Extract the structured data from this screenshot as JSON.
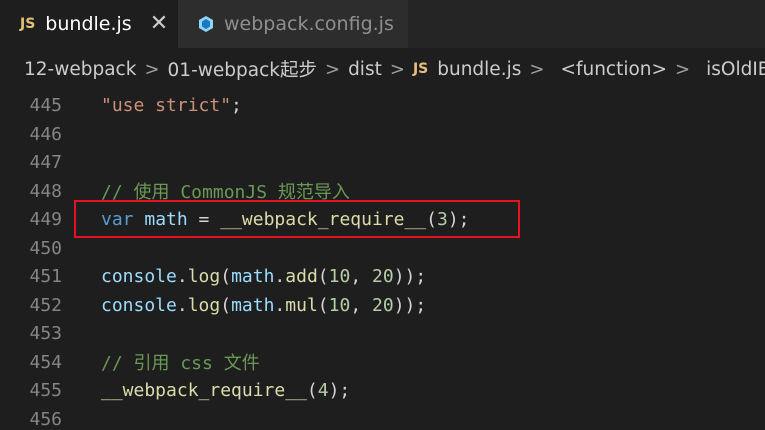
{
  "tabs": [
    {
      "badge": "JS",
      "label": "bundle.js",
      "close": "✕",
      "active": true
    },
    {
      "label": "webpack.config.js",
      "active": false
    }
  ],
  "breadcrumb": {
    "items": [
      "12-webpack",
      "01-webpack起步",
      "dist",
      "bundle.js",
      "<function>",
      "isOldIE"
    ],
    "js_badge": "JS",
    "separator": ">"
  },
  "editor": {
    "lines": [
      {
        "number": "445",
        "tokens": [
          {
            "t": "str",
            "v": "\"use strict\""
          },
          {
            "t": "p",
            "v": ";"
          }
        ]
      },
      {
        "number": "446",
        "tokens": []
      },
      {
        "number": "447",
        "tokens": []
      },
      {
        "number": "448",
        "tokens": [
          {
            "t": "com",
            "v": "// 使用 CommonJS 规范导入"
          }
        ]
      },
      {
        "number": "449",
        "tokens": [
          {
            "t": "kw",
            "v": "var"
          },
          {
            "t": "p",
            "v": " "
          },
          {
            "t": "var",
            "v": "math"
          },
          {
            "t": "p",
            "v": " = "
          },
          {
            "t": "fn",
            "v": "__webpack_require__"
          },
          {
            "t": "p",
            "v": "("
          },
          {
            "t": "num",
            "v": "3"
          },
          {
            "t": "p",
            "v": ");"
          }
        ]
      },
      {
        "number": "450",
        "tokens": []
      },
      {
        "number": "451",
        "tokens": [
          {
            "t": "var",
            "v": "console"
          },
          {
            "t": "p",
            "v": "."
          },
          {
            "t": "fn",
            "v": "log"
          },
          {
            "t": "p",
            "v": "("
          },
          {
            "t": "var",
            "v": "math"
          },
          {
            "t": "p",
            "v": "."
          },
          {
            "t": "fn",
            "v": "add"
          },
          {
            "t": "p",
            "v": "("
          },
          {
            "t": "num",
            "v": "10"
          },
          {
            "t": "p",
            "v": ", "
          },
          {
            "t": "num",
            "v": "20"
          },
          {
            "t": "p",
            "v": "));"
          }
        ]
      },
      {
        "number": "452",
        "tokens": [
          {
            "t": "var",
            "v": "console"
          },
          {
            "t": "p",
            "v": "."
          },
          {
            "t": "fn",
            "v": "log"
          },
          {
            "t": "p",
            "v": "("
          },
          {
            "t": "var",
            "v": "math"
          },
          {
            "t": "p",
            "v": "."
          },
          {
            "t": "fn",
            "v": "mul"
          },
          {
            "t": "p",
            "v": "("
          },
          {
            "t": "num",
            "v": "10"
          },
          {
            "t": "p",
            "v": ", "
          },
          {
            "t": "num",
            "v": "20"
          },
          {
            "t": "p",
            "v": "));"
          }
        ]
      },
      {
        "number": "453",
        "tokens": []
      },
      {
        "number": "454",
        "tokens": [
          {
            "t": "com",
            "v": "// 引用 css 文件"
          }
        ]
      },
      {
        "number": "455",
        "tokens": [
          {
            "t": "fn",
            "v": "__webpack_require__"
          },
          {
            "t": "p",
            "v": "("
          },
          {
            "t": "num",
            "v": "4"
          },
          {
            "t": "p",
            "v": ");"
          }
        ]
      },
      {
        "number": "456",
        "tokens": []
      }
    ]
  },
  "colors": {
    "background": "#1e1e1e",
    "highlight_box": "#e81123"
  }
}
